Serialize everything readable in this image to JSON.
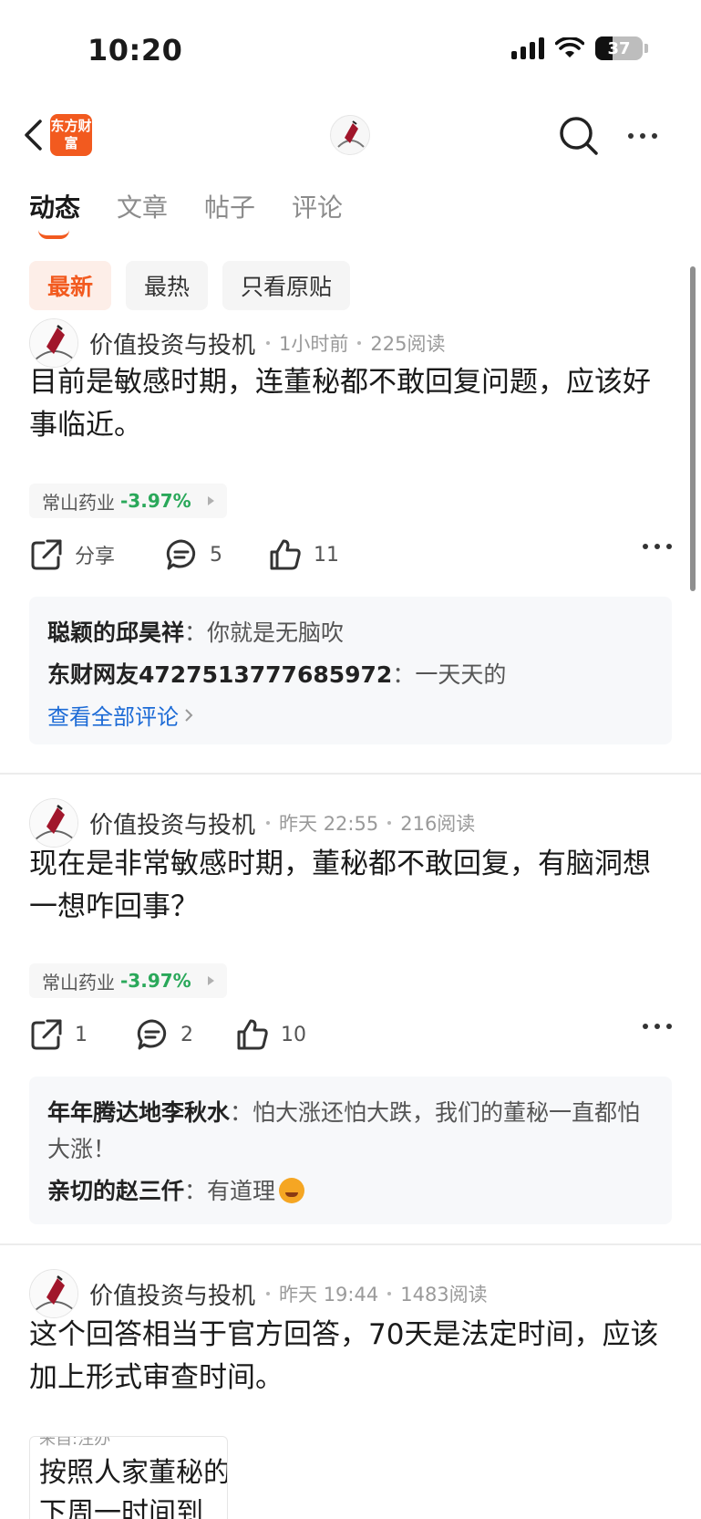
{
  "status": {
    "time": "10:20",
    "battery": "37",
    "battery_fraction": 0.37
  },
  "nav": {
    "brand_text": "东方财富",
    "icons": [
      "back-icon",
      "search-icon",
      "more-icon"
    ]
  },
  "tabs": [
    {
      "label": "动态",
      "active": true
    },
    {
      "label": "文章",
      "active": false
    },
    {
      "label": "帖子",
      "active": false
    },
    {
      "label": "评论",
      "active": false
    }
  ],
  "filters": [
    {
      "label": "最新",
      "active": true
    },
    {
      "label": "最热",
      "active": false
    },
    {
      "label": "只看原贴",
      "active": false
    }
  ],
  "posts": [
    {
      "author": "价值投资与投机",
      "time": "1小时前",
      "reads": "225阅读",
      "content": "目前是敏感时期，连董秘都不敢回复问题，应该好事临近。",
      "stock": {
        "name": "常山药业",
        "change": "-3.97%"
      },
      "share_label": "分享",
      "comment_count": "5",
      "like_count": "11",
      "comments": [
        {
          "author": "聪颖的邱昊祥",
          "sep": "：",
          "text": "你就是无脑吹"
        },
        {
          "author": "东财网友4727513777685972",
          "sep": "：",
          "text": "一天天的"
        }
      ],
      "view_all": "查看全部评论"
    },
    {
      "author": "价值投资与投机",
      "time": "昨天 22:55",
      "reads": "216阅读",
      "content": "现在是非常敏感时期，董秘都不敢回复，有脑洞想一想咋回事？",
      "stock": {
        "name": "常山药业",
        "change": "-3.97%"
      },
      "share_label": "1",
      "comment_count": "2",
      "like_count": "10",
      "comments": [
        {
          "author": "年年腾达地李秋水",
          "sep": "：",
          "text": "怕大涨还怕大跌，我们的董秘一直都怕大涨！"
        },
        {
          "author": "亲切的赵三仟",
          "sep": "：",
          "text": "有道理"
        }
      ]
    },
    {
      "author": "价值投资与投机",
      "time": "昨天 19:44",
      "reads": "1483阅读",
      "content": "这个回答相当于官方回答，70天是法定时间，应该加上形式审查时间。",
      "quote": {
        "source": "来自:注办",
        "text": "按照人家董秘的下周一时间到"
      }
    }
  ]
}
